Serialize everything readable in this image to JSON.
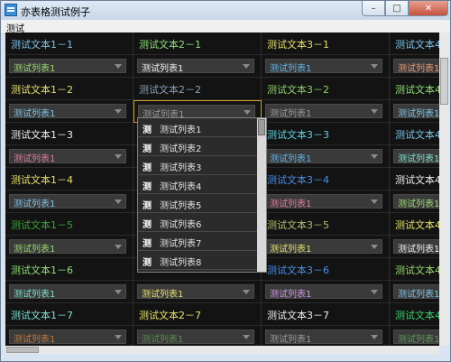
{
  "window": {
    "title": "亦表格测试例子",
    "min_glyph": "–",
    "max_glyph": "□",
    "close_glyph": "✕"
  },
  "menu": {
    "item": "测试"
  },
  "colors": {
    "grid_bg": "#131313",
    "combo_bg": "#3a3a3a",
    "selected_border": "#c9a22b"
  },
  "grid": {
    "rows": [
      {
        "type": "text",
        "cells": [
          {
            "t": "测试文本1－1",
            "c": "#7ec3e8"
          },
          {
            "t": "测试文本2－1",
            "c": "#8fe07a"
          },
          {
            "t": "测试文本3－1",
            "c": "#e6e06e"
          },
          {
            "t": "测试文本4",
            "c": "#7ec3e8"
          }
        ]
      },
      {
        "type": "combo",
        "cells": [
          {
            "t": "测试列表1",
            "c": "#9ad870"
          },
          {
            "t": "测试列表1",
            "c": "#f2f2f2"
          },
          {
            "t": "测试列表1",
            "c": "#5fb6ea"
          },
          {
            "t": "测试列表1",
            "c": "#e89a7a"
          }
        ]
      },
      {
        "type": "text",
        "cells": [
          {
            "t": "测试文本1－2",
            "c": "#e6e06e"
          },
          {
            "t": "测试文本2－2",
            "c": "#8aa2b8"
          },
          {
            "t": "测试文本3－2",
            "c": "#8fd06a"
          },
          {
            "t": "测试文本4",
            "c": "#8fe07a"
          }
        ]
      },
      {
        "type": "combo",
        "cells": [
          {
            "t": "测试列表1",
            "c": "#7ec3e8"
          },
          {
            "t": "测试列表1",
            "c": "#9a9a9a",
            "sel": true
          },
          {
            "t": "测试列表1",
            "c": "#9a9a9a"
          },
          {
            "t": "测试列表1",
            "c": "#7ec3e8"
          }
        ]
      },
      {
        "type": "text",
        "cells": [
          {
            "t": "测试文本1－3",
            "c": "#f0f0f0"
          },
          {
            "t": "",
            "c": "#f0f0f0"
          },
          {
            "t": "测试文本3－3",
            "c": "#5fd4e0"
          },
          {
            "t": "测试文本4",
            "c": "#7ec3e8"
          }
        ]
      },
      {
        "type": "combo",
        "cells": [
          {
            "t": "测试列表1",
            "c": "#e07aa0"
          },
          {
            "t": "",
            "c": "#f0f0f0"
          },
          {
            "t": "测试列表1",
            "c": "#5fb6ea"
          },
          {
            "t": "测试列表1",
            "c": "#7ee0d0"
          }
        ]
      },
      {
        "type": "text",
        "cells": [
          {
            "t": "测试文本1－4",
            "c": "#e6e06e"
          },
          {
            "t": "",
            "c": "#f0f0f0"
          },
          {
            "t": "测试文本3－4",
            "c": "#4a90e8"
          },
          {
            "t": "测试文本4",
            "c": "#f0f0f0"
          }
        ]
      },
      {
        "type": "combo",
        "cells": [
          {
            "t": "测试列表1",
            "c": "#7ec3e8"
          },
          {
            "t": "",
            "c": "#f0f0f0"
          },
          {
            "t": "测试列表1",
            "c": "#e07aa0"
          },
          {
            "t": "测试列表1",
            "c": "#9ad870"
          }
        ]
      },
      {
        "type": "text",
        "cells": [
          {
            "t": "测试文本1－5",
            "c": "#3ea03e"
          },
          {
            "t": "",
            "c": "#f0f0f0"
          },
          {
            "t": "测试文本3－5",
            "c": "#b0c070"
          },
          {
            "t": "测试文本4",
            "c": "#e6e06e"
          }
        ]
      },
      {
        "type": "combo",
        "cells": [
          {
            "t": "测试列表1",
            "c": "#9ad870"
          },
          {
            "t": "",
            "c": "#f0f0f0"
          },
          {
            "t": "测试列表1",
            "c": "#e6e06e"
          },
          {
            "t": "测试列表1",
            "c": "#f0f0f0"
          }
        ]
      },
      {
        "type": "text",
        "cells": [
          {
            "t": "测试文本1－6",
            "c": "#8fe07a"
          },
          {
            "t": "",
            "c": "#f0f0f0"
          },
          {
            "t": "测试文本3－6",
            "c": "#4a90e8"
          },
          {
            "t": "测试文本4",
            "c": "#9ad870"
          }
        ]
      },
      {
        "type": "combo",
        "cells": [
          {
            "t": "测试列表1",
            "c": "#7ee0d0"
          },
          {
            "t": "测试列表1",
            "c": "#e6e06e"
          },
          {
            "t": "测试列表1",
            "c": "#d098e8"
          },
          {
            "t": "测试列表1",
            "c": "#7ec3e8"
          }
        ]
      },
      {
        "type": "text",
        "cells": [
          {
            "t": "测试文本1－7",
            "c": "#7ee0d0"
          },
          {
            "t": "测试文本2－7",
            "c": "#e6e06e"
          },
          {
            "t": "测试文本3－7",
            "c": "#f0f0f0"
          },
          {
            "t": "测试文本4",
            "c": "#3ecf70"
          }
        ]
      },
      {
        "type": "combo",
        "cells": [
          {
            "t": "测试列表1",
            "c": "#c07a3a"
          },
          {
            "t": "测试列表1",
            "c": "#5a8a4a"
          },
          {
            "t": "测试列表1",
            "c": "#9a9a9a"
          },
          {
            "t": "测试列表1",
            "c": "#5a9a5a"
          }
        ]
      }
    ]
  },
  "dropdown": {
    "glyph": "测",
    "items": [
      "测试列表1",
      "测试列表2",
      "测试列表3",
      "测试列表4",
      "测试列表5",
      "测试列表6",
      "测试列表7",
      "测试列表8"
    ]
  }
}
